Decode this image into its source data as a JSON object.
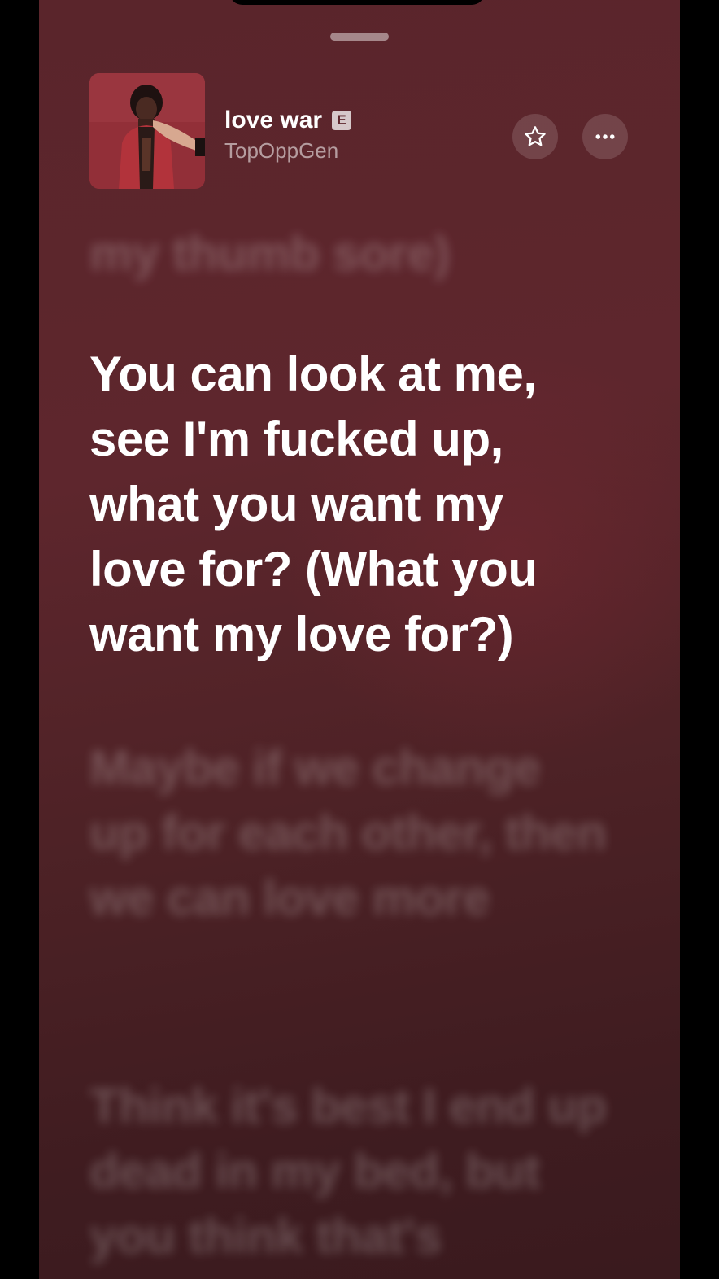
{
  "track": {
    "title": "love war",
    "explicit_badge": "E",
    "artist": "TopOppGen"
  },
  "icons": {
    "favorite": "star-icon",
    "more": "ellipsis-icon"
  },
  "colors": {
    "background": "#5e262d",
    "active_lyric": "#ffffff",
    "inactive_lyric": "rgba(255,255,255,0.22)"
  },
  "lyrics": {
    "previous": "my thumb sore)",
    "current": "You can look at me, see I'm fucked up, what you want my love for? (What you want my love for?)",
    "next_1": "Maybe if we change up for each other, then we can love more",
    "next_2": "Think it's best I end up dead in my bed, but you think that's"
  }
}
